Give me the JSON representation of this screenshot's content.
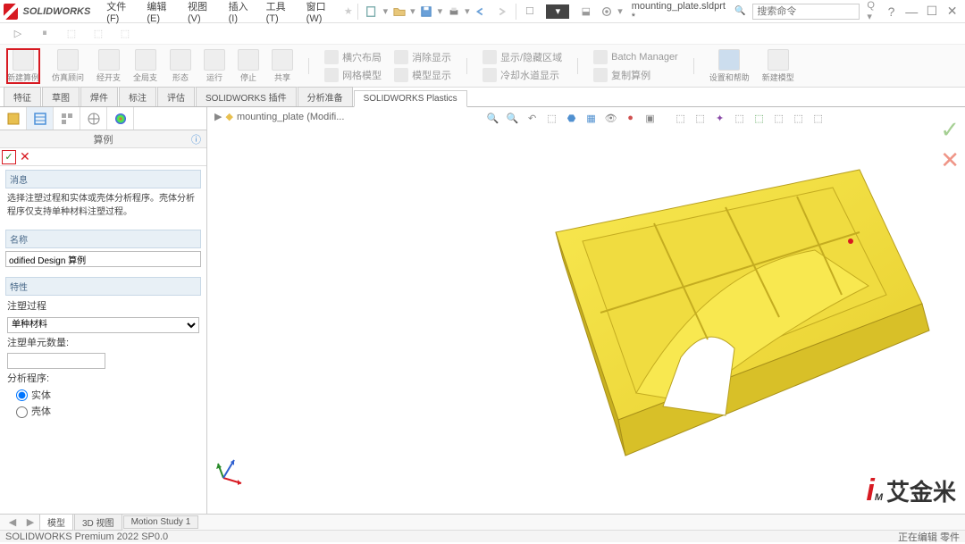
{
  "app": {
    "name": "SOLIDWORKS"
  },
  "menu": [
    "文件(F)",
    "编辑(E)",
    "视图(V)",
    "插入(I)",
    "工具(T)",
    "窗口(W)"
  ],
  "search_placeholder": "搜索命令",
  "filename": "mounting_plate.sldprt *",
  "ribbon_small": [
    "新建算例",
    "仿真顾问",
    "经开支",
    "全局支",
    "形态",
    "运行",
    "停止",
    "共享"
  ],
  "ribbon_text_groups": [
    [
      "横穴布局",
      "消除显示"
    ],
    [
      "网格模型",
      "模型显示"
    ],
    [
      "显示/隐藏区域",
      "冷却水道显示"
    ],
    [
      "Batch Manager",
      "复制算例"
    ]
  ],
  "ribbon_right": [
    "设置和帮助",
    "新建模型"
  ],
  "tabs": [
    "特征",
    "草图",
    "焊件",
    "标注",
    "评估",
    "SOLIDWORKS 插件",
    "分析准备",
    "SOLIDWORKS Plastics"
  ],
  "tabs_active": 7,
  "breadcrumb_text": "mounting_plate (Modifi...",
  "panel": {
    "title": "算例",
    "msg_hdr": "消息",
    "msg_body": "选择注塑过程和实体或壳体分析程序。壳体分析程序仅支持单种材料注塑过程。",
    "name_label": "名称",
    "name_value": "odified Design 算例",
    "props_label": "特性",
    "proc_label": "注塑过程",
    "material_value": "单种材料",
    "units_label": "注塑单元数量:",
    "analysis_label": "分析程序:",
    "radio_solid": "实体",
    "radio_shell": "壳体"
  },
  "bottom_tabs": [
    "模型",
    "3D 视图",
    "Motion Study 1"
  ],
  "status_left": "SOLIDWORKS Premium 2022 SP0.0",
  "status_right": "正在编辑 零件",
  "watermark": "艾金米"
}
